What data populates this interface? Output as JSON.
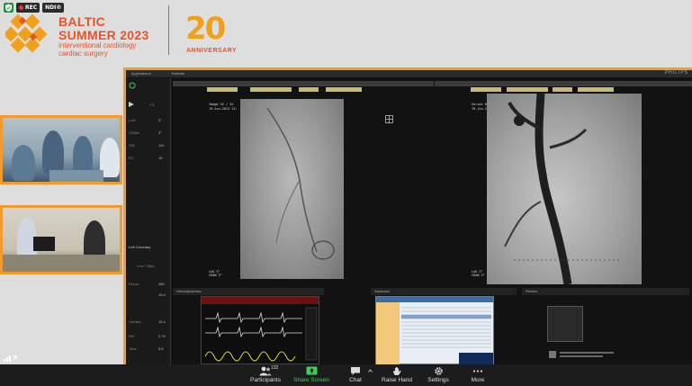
{
  "badges": {
    "rec": "REC",
    "ndi": "NDI®"
  },
  "brand": {
    "line1": "BALTIC",
    "line2": "SUMMER 2023",
    "line3": "interventional cardiology",
    "line4": "cardiac surgery",
    "anniversary_number": "20",
    "anniversary_label": "ANNIVERSARY",
    "colors": {
      "primary": "#e8532a",
      "accent": "#f0a01a"
    }
  },
  "shared_screen": {
    "vendor": "PHILIPS",
    "menu": [
      "Applications",
      "Patients"
    ],
    "left_panel": {
      "frame_rate": "7.5",
      "values": [
        {
          "label": "LAO",
          "value": "3°"
        },
        {
          "label": "CRAN",
          "value": "3°"
        },
        {
          "label": "SID",
          "value": "110"
        },
        {
          "label": "FD",
          "value": "15"
        }
      ],
      "acq_label": "Left Coronary",
      "acq_setting": "Low 7.5fps",
      "dose_rows": [
        {
          "label": "Fluoro",
          "value": "260"
        },
        {
          "label": "",
          "value": "16.4"
        },
        {
          "label": "Cardiac",
          "value": "15.4"
        },
        {
          "label": "Ref",
          "value": "2.74"
        },
        {
          "label": "Total",
          "value": "5.6"
        }
      ]
    },
    "viewer_left": {
      "image_text": "Image 32 / 32",
      "date_text": "19-Jun-2023 12:",
      "angle_text": "LAO 3°\nCRAN 3°"
    },
    "viewer_right": {
      "series_text": "Series 8",
      "date_text": "19-Jun-2023",
      "angle_text": "LAO 3°\nCRAN 3°"
    },
    "bottom_windows": [
      "Hemodynamics",
      "Database",
      "Review"
    ]
  },
  "toolbar": {
    "participants_count": "132",
    "items": [
      {
        "label": "Participants",
        "icon": "participants-icon"
      },
      {
        "label": "Share Screen",
        "icon": "share-screen-icon"
      },
      {
        "label": "Chat",
        "icon": "chat-icon"
      },
      {
        "label": "Raise Hand",
        "icon": "raise-hand-icon"
      },
      {
        "label": "Settings",
        "icon": "gear-icon"
      },
      {
        "label": "More",
        "icon": "more-icon"
      }
    ],
    "colors": {
      "share": "#3ecf5a",
      "bar": "#1c1c1c"
    }
  }
}
